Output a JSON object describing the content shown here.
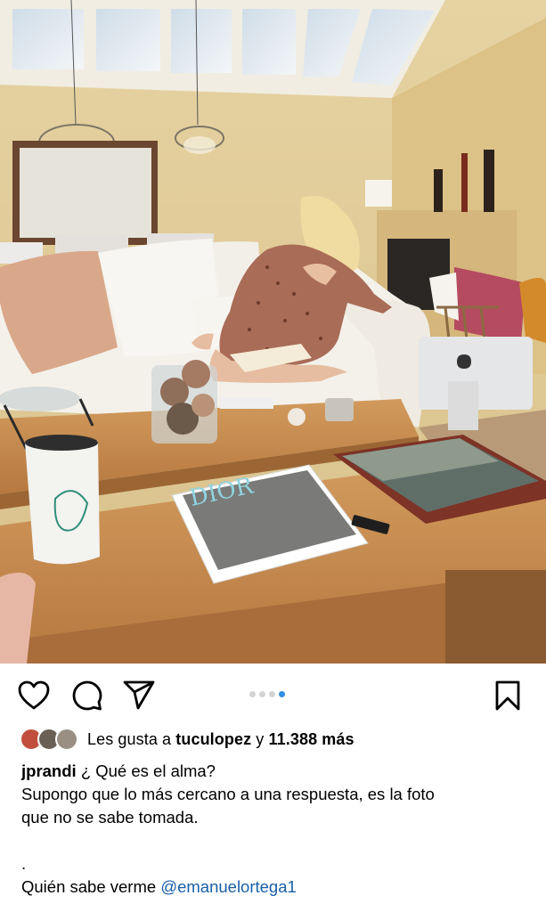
{
  "post": {
    "image_description_icons": [
      "dior-magazine",
      "mac-computer"
    ],
    "carousel": {
      "count": 4,
      "active_index": 3
    }
  },
  "actions": {
    "like_icon": "heart-icon",
    "comment_icon": "comment-icon",
    "share_icon": "send-icon",
    "save_icon": "bookmark-icon"
  },
  "likes": {
    "prefix": "Les gusta a",
    "user": "tuculopez",
    "connector": "y",
    "count": "11.388 más"
  },
  "caption": {
    "username": "jprandi",
    "first_line": "¿ Qué es el alma?",
    "line2": "Supongo que lo más cercano a una respuesta, es la foto",
    "line3": "que no se sabe tomada.",
    "line4": ".",
    "line5_text": "Quién sabe verme",
    "line5_mention": "@emanuelortega1"
  },
  "colors": {
    "accent": "#2e8fe6",
    "mention": "#1a5fa8"
  }
}
